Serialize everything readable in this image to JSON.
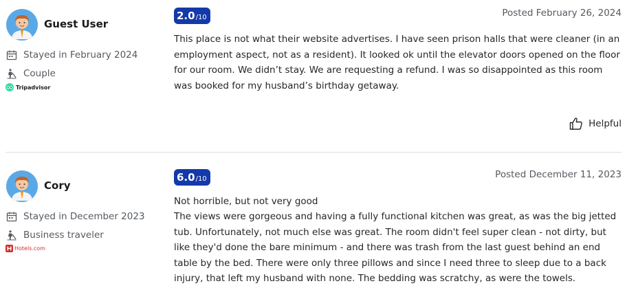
{
  "reviews": [
    {
      "reviewer_name": "Guest User",
      "avatar_icon": "avatar-icon",
      "stay": "Stayed in February 2024",
      "traveler_type": "Couple",
      "source": "Tripadvisor",
      "score": "2.0",
      "score_max": "/10",
      "posted": "Posted February 26, 2024",
      "body": "This place is not what their website advertises. I have seen prison halls that were cleaner (in an employment aspect, not as a resident). It looked ok until the elevator doors opened on the floor for our room. We didn’t stay. We are requesting a refund. I was so disappointed as this room was booked for my husband’s birthday getaway.",
      "helpful_label": "Helpful"
    },
    {
      "reviewer_name": "Cory",
      "avatar_icon": "avatar-icon",
      "stay": "Stayed in December 2023",
      "traveler_type": "Business traveler",
      "source": "Hotels.com",
      "score": "6.0",
      "score_max": "/10",
      "posted": "Posted December 11, 2023",
      "title": "Not horrible, but not very good",
      "body": "The views were gorgeous and having a fully functional kitchen was great, as was the big jetted tub. Unfortunately, not much else was great.  The room didn't feel super clean - not dirty, but like they'd done the bare minimum - and there was trash from the last guest behind an end table by the bed.  There were only three pillows and since I need three to sleep due to a back injury, that left my husband with none. The bedding was scratchy, as were the towels."
    }
  ],
  "colors": {
    "score_badge": "#1439a8",
    "divider": "#dfe0e4",
    "meta_text": "#555a60"
  }
}
